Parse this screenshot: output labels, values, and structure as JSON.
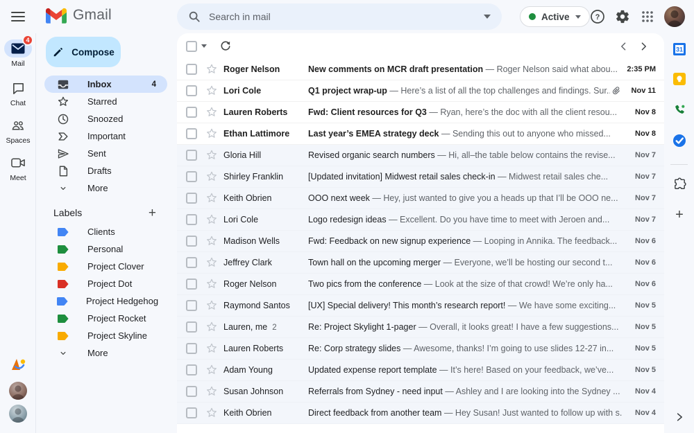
{
  "topbar": {
    "brand": "Gmail",
    "search_placeholder": "Search in mail",
    "status_label": "Active"
  },
  "rail": {
    "items": [
      {
        "label": "Mail",
        "badge": "4"
      },
      {
        "label": "Chat"
      },
      {
        "label": "Spaces"
      },
      {
        "label": "Meet"
      }
    ]
  },
  "sidebar": {
    "compose_label": "Compose",
    "items": [
      {
        "label": "Inbox",
        "count": "4",
        "active": true
      },
      {
        "label": "Starred"
      },
      {
        "label": "Snoozed"
      },
      {
        "label": "Important"
      },
      {
        "label": "Sent"
      },
      {
        "label": "Drafts"
      },
      {
        "label": "More"
      }
    ],
    "labels_heading": "Labels",
    "labels": [
      {
        "name": "Clients",
        "color": "#4285f4"
      },
      {
        "name": "Personal",
        "color": "#1e8e3e"
      },
      {
        "name": "Project Clover",
        "color": "#f9ab00"
      },
      {
        "name": "Project Dot",
        "color": "#d93025"
      },
      {
        "name": "Project Hedgehog",
        "color": "#4285f4"
      },
      {
        "name": "Project Rocket",
        "color": "#1e8e3e"
      },
      {
        "name": "Project Skyline",
        "color": "#f9ab00"
      }
    ],
    "more_labels": "More"
  },
  "list": {
    "rows": [
      {
        "sender": "Roger Nelson",
        "subject": "New comments on MCR draft presentation",
        "snippet": "— Roger Nelson said what abou...",
        "date": "2:35 PM",
        "unread": true
      },
      {
        "sender": "Lori Cole",
        "subject": "Q1 project wrap-up",
        "snippet": "— Here’s a list of all the top challenges and findings. Sur...",
        "date": "Nov 11",
        "unread": true,
        "attachment": true
      },
      {
        "sender": "Lauren Roberts",
        "subject": "Fwd: Client resources for Q3",
        "snippet": "— Ryan, here’s the doc with all the client resou...",
        "date": "Nov 8",
        "unread": true
      },
      {
        "sender": "Ethan Lattimore",
        "subject": "Last year’s EMEA strategy deck",
        "snippet": "— Sending this out to anyone who missed...",
        "date": "Nov 8",
        "unread": true
      },
      {
        "sender": "Gloria Hill",
        "subject": "Revised organic search numbers",
        "snippet": "— Hi, all–the table below contains the revise...",
        "date": "Nov 7"
      },
      {
        "sender": "Shirley Franklin",
        "subject": "[Updated invitation] Midwest retail sales check-in",
        "snippet": "— Midwest retail sales che...",
        "date": "Nov 7"
      },
      {
        "sender": "Keith Obrien",
        "subject": "OOO next week",
        "snippet": "— Hey, just wanted to give you a heads up that I’ll be OOO ne...",
        "date": "Nov 7"
      },
      {
        "sender": "Lori Cole",
        "subject": "Logo redesign ideas",
        "snippet": "— Excellent. Do you have time to meet with Jeroen and...",
        "date": "Nov 7"
      },
      {
        "sender": "Madison Wells",
        "subject": "Fwd: Feedback on new signup experience",
        "snippet": "— Looping in Annika. The feedback...",
        "date": "Nov 6"
      },
      {
        "sender": "Jeffrey Clark",
        "subject": "Town hall on the upcoming merger",
        "snippet": "— Everyone, we’ll be hosting our second t...",
        "date": "Nov 6"
      },
      {
        "sender": "Roger Nelson",
        "subject": "Two pics from the conference",
        "snippet": "— Look at the size of that crowd! We’re only ha...",
        "date": "Nov 6"
      },
      {
        "sender": "Raymond Santos",
        "subject": "[UX] Special delivery! This month’s research report!",
        "snippet": "— We have some exciting...",
        "date": "Nov 5"
      },
      {
        "sender": "Lauren, me",
        "thread_count": "2",
        "subject": "Re: Project Skylight 1-pager",
        "snippet": "— Overall, it looks great! I have a few suggestions...",
        "date": "Nov 5"
      },
      {
        "sender": "Lauren Roberts",
        "subject": "Re: Corp strategy slides",
        "snippet": "— Awesome, thanks! I’m going to use slides 12-27 in...",
        "date": "Nov 5"
      },
      {
        "sender": "Adam Young",
        "subject": "Updated expense report template",
        "snippet": "— It’s here! Based on your feedback, we’ve...",
        "date": "Nov 5"
      },
      {
        "sender": "Susan Johnson",
        "subject": "Referrals from Sydney - need input",
        "snippet": "— Ashley and I are looking into the Sydney ...",
        "date": "Nov 4"
      },
      {
        "sender": "Keith Obrien",
        "subject": "Direct feedback from another team",
        "snippet": "— Hey Susan! Just wanted to follow up with s...",
        "date": "Nov 4"
      }
    ]
  },
  "sidepanel": {
    "calendar_label": "31"
  }
}
